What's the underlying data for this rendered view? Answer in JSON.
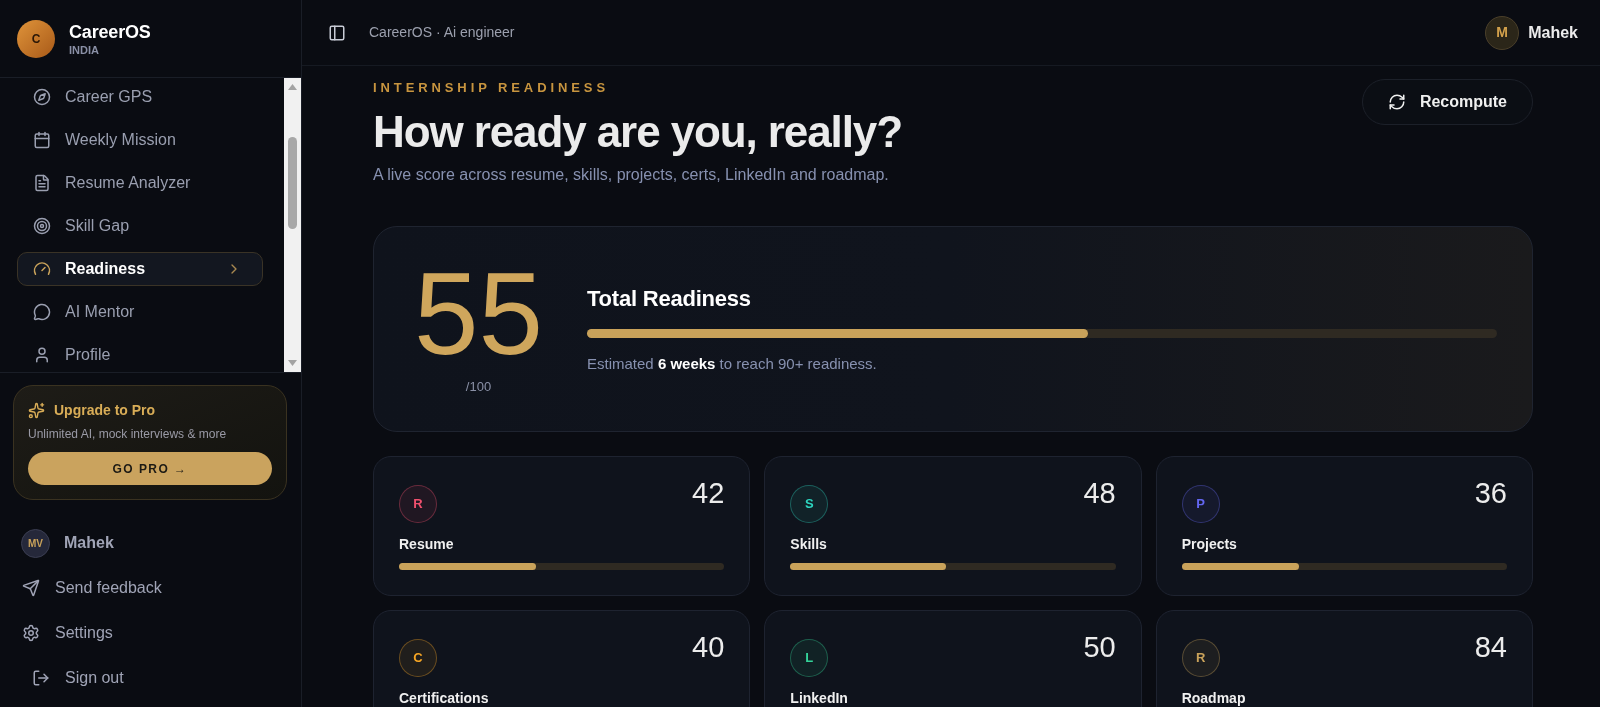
{
  "sidebar": {
    "brand": {
      "logo_letter": "C",
      "name": "CareerOS",
      "region": "INDIA"
    },
    "nav_items": [
      {
        "label": "Career GPS",
        "selected": false
      },
      {
        "label": "Weekly Mission",
        "selected": false
      },
      {
        "label": "Resume Analyzer",
        "selected": false
      },
      {
        "label": "Skill Gap",
        "selected": false
      },
      {
        "label": "Readiness",
        "selected": true
      },
      {
        "label": "AI Mentor",
        "selected": false
      },
      {
        "label": "Profile",
        "selected": false
      }
    ],
    "upgrade": {
      "title": "Upgrade to Pro",
      "description": "Unlimited AI, mock interviews & more",
      "button": "GO PRO →"
    },
    "user": {
      "initials": "MV",
      "name": "Mahek"
    },
    "links": [
      {
        "label": "Send feedback"
      },
      {
        "label": "Settings"
      },
      {
        "label": "Sign out"
      }
    ]
  },
  "topbar": {
    "breadcrumb": "CareerOS · Ai engineer",
    "user": {
      "initial": "M",
      "name": "Mahek"
    }
  },
  "header": {
    "eyebrow": "INTERNSHIP READINESS",
    "title": "How ready are you, really?",
    "subtitle": "A live score across resume, skills, projects, certs, LinkedIn and roadmap.",
    "action": "Recompute"
  },
  "total": {
    "score": "55",
    "max": "/100",
    "title": "Total Readiness",
    "level": 0.55,
    "note": "Estimated **6 weeks** to reach 90+ readiness."
  },
  "categories": [
    {
      "letter": "R",
      "label": "Resume",
      "score": "42",
      "level": 0.42,
      "color": "#f0506e"
    },
    {
      "letter": "S",
      "label": "Skills",
      "score": "48",
      "level": 0.48,
      "color": "#2dd4bf"
    },
    {
      "letter": "P",
      "label": "Projects",
      "score": "36",
      "level": 0.36,
      "color": "#6366f1"
    },
    {
      "letter": "C",
      "label": "Certifications",
      "score": "40",
      "color": "#f5a524"
    },
    {
      "letter": "L",
      "label": "LinkedIn",
      "score": "50",
      "color": "#34d399"
    },
    {
      "letter": "R",
      "label": "Roadmap",
      "score": "84",
      "color": "#c9a25a"
    }
  ]
}
